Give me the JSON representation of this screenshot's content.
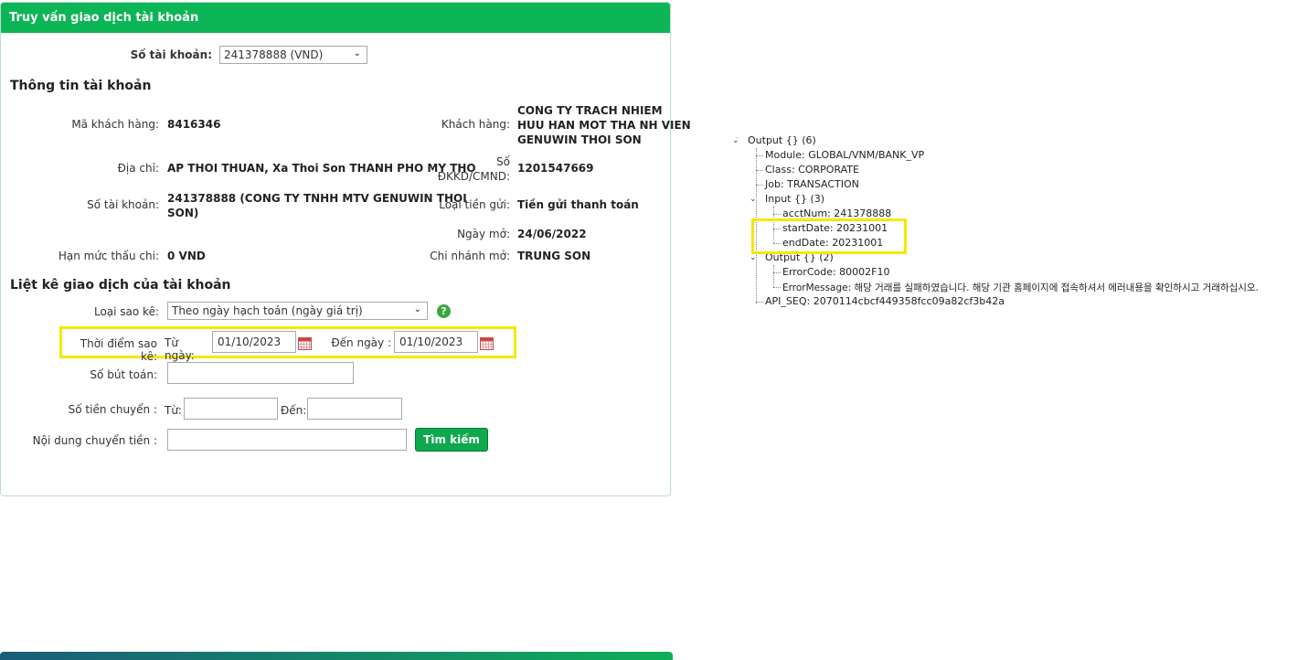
{
  "panel": {
    "title": "Truy vấn giao dịch tài khoản",
    "account_select_label": "Số tài khoản:",
    "account_select_value": "241378888 (VND)",
    "info_title": "Thông tin tài khoản",
    "customer_code_label": "Mã khách hàng:",
    "customer_code": "8416346",
    "customer_label": "Khách hàng:",
    "customer_name_lines": [
      "CONG TY TRACH NHIEM",
      "HUU HAN MOT THA NH VIEN",
      "GENUWIN THOI SON"
    ],
    "address_label": "Địa chỉ:",
    "address": "AP THOI THUAN, Xa Thoi Son THANH PHO MY THO",
    "reg_no_label_lines": [
      "Số",
      "ĐKKD/CMND:"
    ],
    "reg_no": "1201547669",
    "account_no_label": "Số tài khoản:",
    "account_no_lines": [
      "241378888 (CONG TY TNHH MTV GENUWIN THOI",
      "SON)"
    ],
    "deposit_type_label": "Loại tiền gửi:",
    "deposit_type": "Tiền gửi thanh toán",
    "open_date_label": "Ngày mở:",
    "open_date": "24/06/2022",
    "overdraft_label": "Hạn mức thấu chi:",
    "overdraft": "0 VND",
    "branch_label": "Chi nhánh mở:",
    "branch": "TRUNG SON",
    "list_title": "Liệt kê giao dịch của tài khoản",
    "statement_type_label": "Loại sao kê:",
    "statement_type_value": "Theo ngày hạch toán (ngày giá trị)",
    "help_glyph": "?",
    "period_label": "Thời điểm sao kê:",
    "from_date_label": "Từ ngày:",
    "from_date": "01/10/2023",
    "to_date_label": "Đến ngày :",
    "to_date": "01/10/2023",
    "entry_no_label": "Số bút toán:",
    "amount_label": "Số tiền chuyển :",
    "amount_from_label": "Từ:",
    "amount_to_label": "Đến:",
    "content_label": "Nội dung chuyển tiền :",
    "search_button": "Tìm kiếm"
  },
  "icons": {
    "select_chevron": "chevron-down-icon",
    "calendar": "calendar-icon",
    "help": "help-icon"
  },
  "tree": {
    "output_root": "Output {} (6)",
    "module": "Module: GLOBAL/VNM/BANK_VP",
    "class": "Class: CORPORATE",
    "job": "Job: TRANSACTION",
    "input": "Input {} (3)",
    "acct_num": "acctNum: 241378888",
    "start_date": "startDate: 20231001",
    "end_date": "endDate: 20231001",
    "output_child": "Output {} (2)",
    "error_code": "ErrorCode: 80002F10",
    "error_message": "ErrorMessage: 해당 거래를 실패하였습니다. 해당 기관 홈페이지에 접속하셔서 에러내용을 확인하시고 거래하십시오.",
    "api_seq": "API_SEQ: 2070114cbcf449358fcc09a82cf3b42a"
  },
  "colors": {
    "header_green": "#0cb555",
    "highlight_yellow": "#f5e800",
    "button_green": "#0ea84f"
  }
}
